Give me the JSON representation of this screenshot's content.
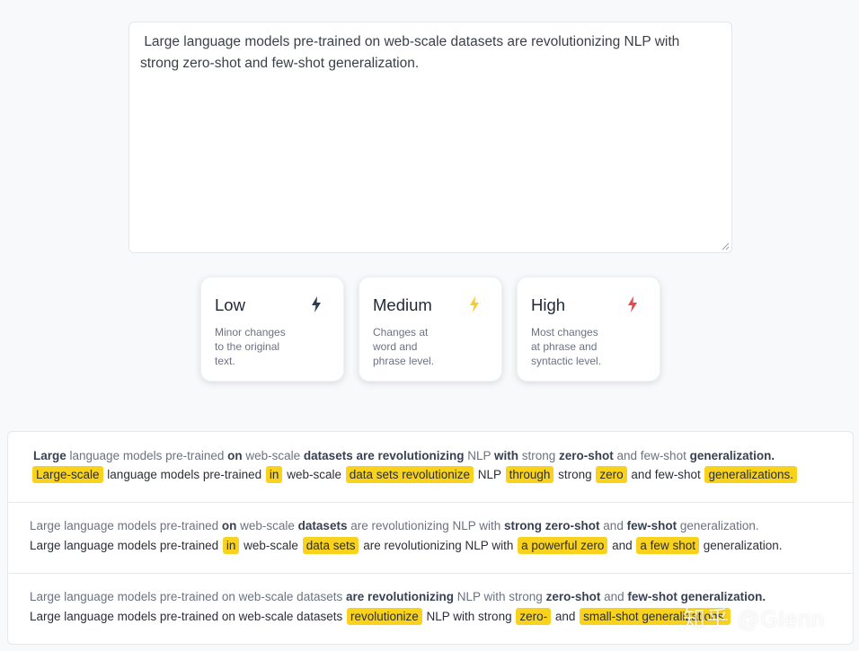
{
  "editor": {
    "text": " Large language models pre-trained on web-scale datasets are revolutionizing NLP with strong zero-shot and few-shot generalization."
  },
  "levels": [
    {
      "title": "Low",
      "desc": "Minor changes to the original text.",
      "icon": "lightning-bolt-icon",
      "icon_color": "#2b3a55"
    },
    {
      "title": "Medium",
      "desc": "Changes at word and phrase level.",
      "icon": "lightning-bolt-icon",
      "icon_color": "#f6cc2a"
    },
    {
      "title": "High",
      "desc": "Most changes at phrase and syntactic level.",
      "icon": "lightning-bolt-icon",
      "icon_color": "#e5484d"
    }
  ],
  "results": [
    {
      "original": [
        {
          "t": "Large",
          "b": true
        },
        {
          "t": " language models pre-trained "
        },
        {
          "t": "on",
          "b": true
        },
        {
          "t": " web-scale "
        },
        {
          "t": "datasets are revolutionizing",
          "b": true
        },
        {
          "t": " NLP "
        },
        {
          "t": "with",
          "b": true
        },
        {
          "t": " strong "
        },
        {
          "t": "zero-shot",
          "b": true
        },
        {
          "t": " and few-shot "
        },
        {
          "t": "generalization.",
          "b": true
        }
      ],
      "paraphrase": [
        {
          "t": "Large-scale",
          "h": true
        },
        {
          "t": " language models pre-trained "
        },
        {
          "t": "in",
          "h": true
        },
        {
          "t": " web-scale "
        },
        {
          "t": "data sets revolutionize",
          "h": true
        },
        {
          "t": " NLP "
        },
        {
          "t": "through",
          "h": true
        },
        {
          "t": " strong "
        },
        {
          "t": "zero",
          "h": true
        },
        {
          "t": " and few-shot "
        },
        {
          "t": "generalizations.",
          "h": true
        }
      ]
    },
    {
      "original": [
        {
          "t": "Large language models pre-trained "
        },
        {
          "t": "on",
          "b": true
        },
        {
          "t": " web-scale "
        },
        {
          "t": "datasets",
          "b": true
        },
        {
          "t": " are revolutionizing NLP with "
        },
        {
          "t": "strong zero-shot",
          "b": true
        },
        {
          "t": " and "
        },
        {
          "t": "few-shot",
          "b": true
        },
        {
          "t": " generalization."
        }
      ],
      "paraphrase": [
        {
          "t": "Large language models pre-trained "
        },
        {
          "t": "in",
          "h": true
        },
        {
          "t": " web-scale "
        },
        {
          "t": "data sets",
          "h": true
        },
        {
          "t": " are revolutionizing NLP with "
        },
        {
          "t": "a powerful zero",
          "h": true
        },
        {
          "t": " and "
        },
        {
          "t": "a few shot",
          "h": true
        },
        {
          "t": " generalization."
        }
      ]
    },
    {
      "original": [
        {
          "t": "Large language models pre-trained on web-scale datasets "
        },
        {
          "t": "are revolutionizing",
          "b": true
        },
        {
          "t": " NLP with strong "
        },
        {
          "t": "zero-shot",
          "b": true
        },
        {
          "t": " and "
        },
        {
          "t": "few-shot generalization.",
          "b": true
        }
      ],
      "paraphrase": [
        {
          "t": "Large language models pre-trained on web-scale datasets "
        },
        {
          "t": "revolutionize",
          "h": true
        },
        {
          "t": " NLP with strong "
        },
        {
          "t": "zero-",
          "h": true
        },
        {
          "t": " and "
        },
        {
          "t": "small-shot generalizations.",
          "h": true
        }
      ]
    }
  ],
  "watermark": "知乎 @Glenn"
}
